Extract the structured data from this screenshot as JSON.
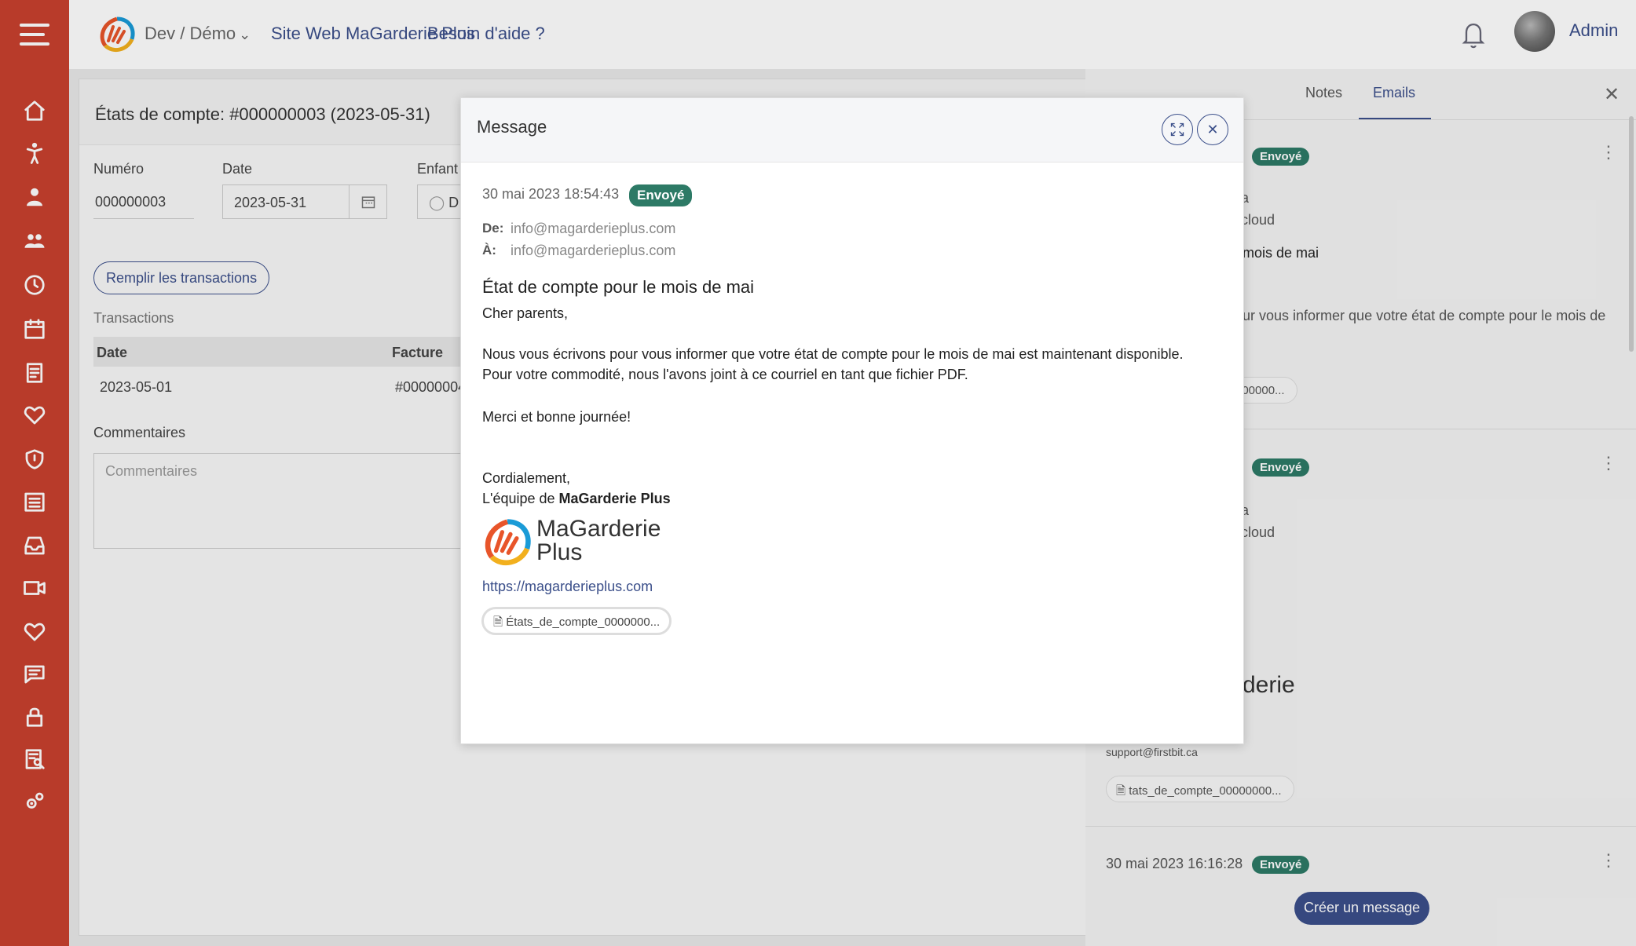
{
  "header": {
    "org": "Dev / Démo",
    "links": [
      "Site Web MaGarderie Plus",
      "Besoin d'aide ?"
    ],
    "user": "Admin"
  },
  "page": {
    "title": "États de compte: #000000003 (2023-05-31)",
    "fields": {
      "numero_label": "Numéro",
      "numero_value": "000000003",
      "date_label": "Date",
      "date_value": "2023-05-31",
      "enfant_label": "Enfant",
      "enfant_value": "D"
    },
    "fill_button": "Remplir les transactions",
    "transactions_label": "Transactions",
    "table": {
      "headers": [
        "Date",
        "Facture"
      ],
      "rows": [
        [
          "2023-05-01",
          "#00000004"
        ]
      ]
    },
    "comments_label": "Commentaires",
    "comments_placeholder": "Commentaires"
  },
  "right_panel": {
    "tabs": [
      "Notes",
      "Emails"
    ],
    "emails": [
      {
        "badge": "Envoyé",
        "line1": "a",
        "line2": "cloud",
        "subject_fragment": "mois de mai",
        "body_fragment": "ur vous informer que votre état de compte pour le mois de",
        "attachment": "000000..."
      },
      {
        "badge": "Envoyé",
        "line1": "a",
        "line2": "cloud",
        "logo_fragment": "derie",
        "support": "support@firstbit.ca",
        "attachment": "tats_de_compte_00000000..."
      },
      {
        "date": "30 mai 2023 16:16:28",
        "badge": "Envoyé"
      }
    ],
    "create_button": "Créer un message"
  },
  "modal": {
    "title": "Message",
    "date": "30 mai 2023 18:54:43",
    "badge": "Envoyé",
    "from_label": "De:",
    "from": "info@magarderieplus.com",
    "to_label": "À:",
    "to": "info@magarderieplus.com",
    "subject": "État de compte pour le mois de mai",
    "greeting": "Cher parents,",
    "body1": "Nous vous écrivons pour vous informer que votre état de compte pour le mois de mai est maintenant disponible.",
    "body2": "Pour votre commodité, nous l'avons joint à ce courriel en tant que fichier PDF.",
    "thanks": "Merci et bonne journée!",
    "closing": "Cordialement,",
    "team_prefix": "L'équipe de ",
    "team_name": "MaGarderie Plus",
    "logo_text_1": "MaGarderie",
    "logo_text_2": "Plus",
    "link": "https://magarderieplus.com",
    "attachment": "États_de_compte_0000000..."
  },
  "colors": {
    "sidebar": "#c8402e",
    "primary": "#3b4f8a",
    "badge": "#2d7a66"
  }
}
